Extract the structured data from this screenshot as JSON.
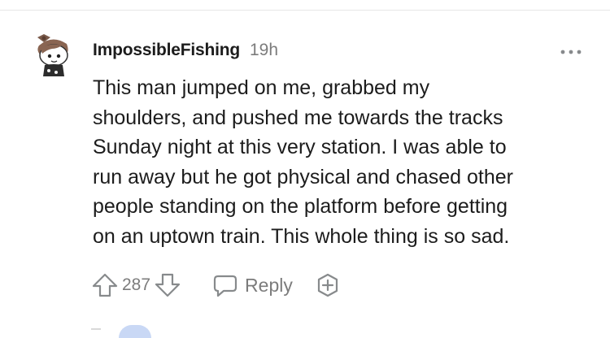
{
  "comment": {
    "username": "ImpossibleFishing",
    "timestamp": "19h",
    "body_lines": [
      "This man jumped on me, grabbed my",
      "shoulders, and pushed me towards the tracks",
      "Sunday night at this very station. I was able to",
      "run away but he got physical and chased other",
      "people standing on the platform before getting",
      "on an uptown train. This whole thing is so sad."
    ],
    "score": "287",
    "reply_label": "Reply"
  },
  "icons": {
    "avatar": "snoo-avatar",
    "more": "more-horizontal-icon",
    "upvote": "arrow-up-icon",
    "downvote": "arrow-down-icon",
    "reply": "speech-bubble-icon",
    "award": "award-icon"
  },
  "colors": {
    "text": "#1c1c1c",
    "muted": "#7c7c7c",
    "icon": "#878a8c",
    "divider": "#e6e6e6"
  }
}
